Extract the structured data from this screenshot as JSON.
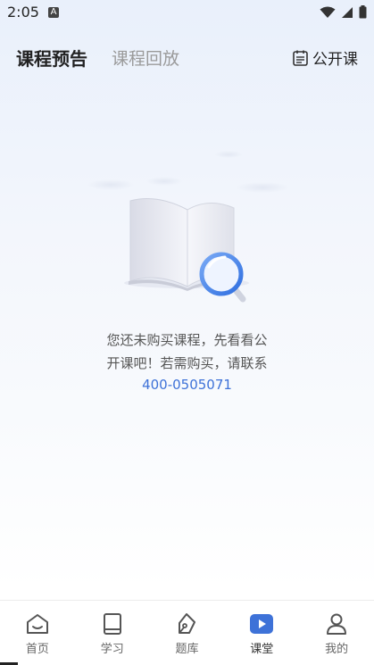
{
  "status_bar": {
    "time": "2:05",
    "notification_letter": "A"
  },
  "header": {
    "tab_preview": "课程预告",
    "tab_replay": "课程回放",
    "open_class_label": "公开课"
  },
  "empty_state": {
    "line1": "您还未购买课程，先看看公",
    "line2": "开课吧！若需购买，请联系",
    "phone": "400-0505071"
  },
  "bottom_nav": {
    "items": [
      {
        "label": "首页",
        "icon": "home-icon"
      },
      {
        "label": "学习",
        "icon": "book-icon"
      },
      {
        "label": "题库",
        "icon": "pen-icon"
      },
      {
        "label": "课堂",
        "icon": "play-icon",
        "active": true
      },
      {
        "label": "我的",
        "icon": "user-icon"
      }
    ]
  },
  "colors": {
    "accent": "#3e72d8",
    "link": "#3e72d8"
  }
}
